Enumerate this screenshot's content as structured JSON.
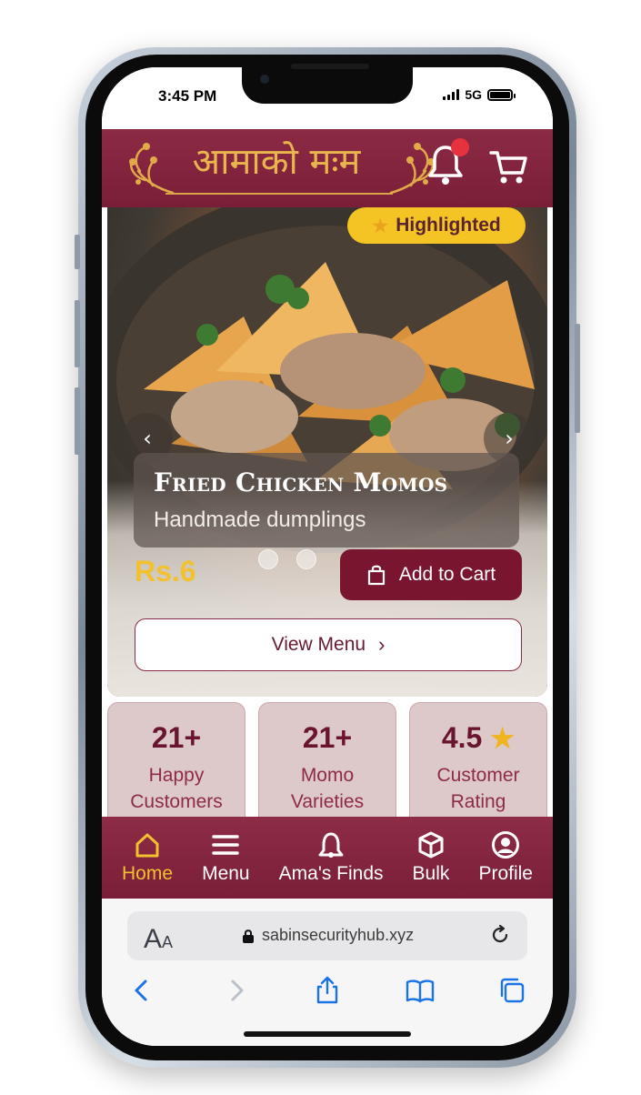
{
  "status_bar": {
    "time": "3:45 PM",
    "network": "5G"
  },
  "header": {
    "logo_text": "आमाको मःम",
    "notification_icon": "bell-icon",
    "cart_icon": "cart-icon"
  },
  "hero": {
    "badge": "Highlighted",
    "badge_icon": "star-icon",
    "title": "Fried Chicken Momos",
    "subtitle": "Handmade dumplings",
    "price": "Rs.6",
    "add_to_cart_label": "Add to Cart",
    "view_menu_label": "View Menu",
    "slide_count": 3
  },
  "stats": [
    {
      "value": "21+",
      "label_line1": "Happy",
      "label_line2": "Customers"
    },
    {
      "value": "21+",
      "label_line1": "Momo",
      "label_line2": "Varieties"
    },
    {
      "value": "4.5",
      "label_line1": "Customer",
      "label_line2": "Rating"
    }
  ],
  "bottom_nav": [
    {
      "label": "Home",
      "icon": "home-icon",
      "active": true
    },
    {
      "label": "Menu",
      "icon": "menu-icon",
      "active": false
    },
    {
      "label": "Ama's Finds",
      "icon": "finds-icon",
      "active": false
    },
    {
      "label": "Bulk",
      "icon": "box-icon",
      "active": false
    },
    {
      "label": "Profile",
      "icon": "profile-icon",
      "active": false
    }
  ],
  "browser": {
    "text_size_label": "AA",
    "url": "sabinsecurityhub.xyz"
  },
  "colors": {
    "brand": "#7a1e38",
    "accent": "#f2c12e",
    "badge": "#f3c423"
  }
}
